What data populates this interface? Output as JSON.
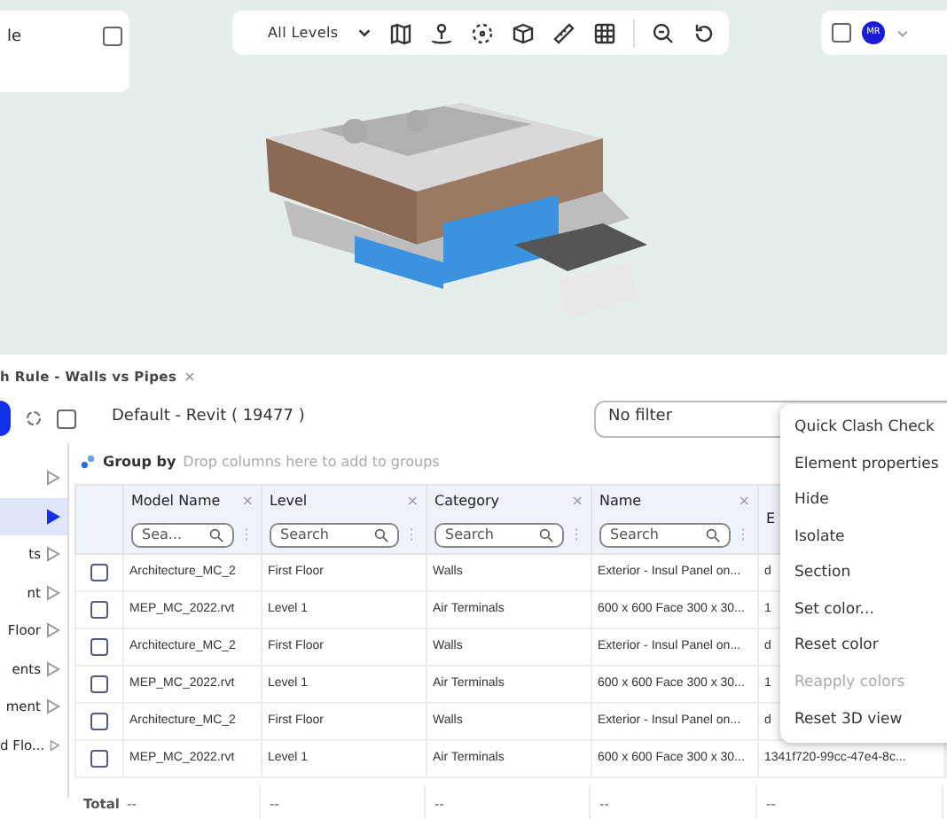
{
  "top_left_panel": {
    "title": "le"
  },
  "toolbar": {
    "level_select": "All Levels"
  },
  "user": {
    "initials": "MR"
  },
  "tab": {
    "title": "h Rule - Walls vs Pipes",
    "close": "×"
  },
  "view_title": "Default - Revit ( 19477 )",
  "filter": {
    "value": "No filter"
  },
  "group_by": {
    "label": "Group by",
    "placeholder": "Drop columns here to add to groups"
  },
  "sidebar": {
    "items": [
      {
        "selected": false
      },
      {
        "selected": true
      },
      {
        "label": "ts",
        "selected": false
      },
      {
        "label": "nt",
        "selected": false
      },
      {
        "label": "Floor",
        "selected": false
      },
      {
        "label": "ents",
        "selected": false
      },
      {
        "label": "ment",
        "selected": false
      },
      {
        "label": "d Flo...",
        "selected": false
      }
    ]
  },
  "table": {
    "columns": [
      {
        "title": "Model Name",
        "close": "×",
        "search": "Sea...",
        "menu": "⋮"
      },
      {
        "title": "Level",
        "close": "×",
        "search": "Search",
        "menu": "⋮"
      },
      {
        "title": "Category",
        "close": "×",
        "search": "Search",
        "menu": "⋮"
      },
      {
        "title": "Name",
        "close": "×",
        "search": "Search",
        "menu": "⋮"
      },
      {
        "title": "E"
      }
    ],
    "rows": [
      {
        "checked": false,
        "cells": [
          "Architecture_MC_2",
          "First Floor",
          "Walls",
          "Exterior - Insul Panel on...",
          "d"
        ]
      },
      {
        "checked": false,
        "cells": [
          "MEP_MC_2022.rvt",
          "Level 1",
          "Air Terminals",
          "600 x 600 Face 300 x 30...",
          "1"
        ]
      },
      {
        "checked": false,
        "cells": [
          "Architecture_MC_2",
          "First Floor",
          "Walls",
          "Exterior - Insul Panel on...",
          "d"
        ]
      },
      {
        "checked": false,
        "cells": [
          "MEP_MC_2022.rvt",
          "Level 1",
          "Air Terminals",
          "600 x 600 Face 300 x 30...",
          "1"
        ]
      },
      {
        "checked": false,
        "cells": [
          "Architecture_MC_2",
          "First Floor",
          "Walls",
          "Exterior - Insul Panel on...",
          "d"
        ]
      },
      {
        "checked": false,
        "cells": [
          "MEP_MC_2022.rvt",
          "Level 1",
          "Air Terminals",
          "600 x 600 Face 300 x 30...",
          "1341f720-99cc-47e4-8c..."
        ]
      }
    ],
    "total": {
      "label": "Total",
      "values": [
        "--",
        "--",
        "--",
        "--",
        "--"
      ]
    }
  },
  "context_menu": {
    "items": [
      {
        "label": "Quick Clash Check",
        "disabled": false
      },
      {
        "label": "Element properties",
        "disabled": false
      },
      {
        "label": "Hide",
        "disabled": false
      },
      {
        "label": "Isolate",
        "disabled": false
      },
      {
        "label": "Section",
        "disabled": false
      },
      {
        "label": "Set color...",
        "disabled": false
      },
      {
        "label": "Reset color",
        "disabled": false
      },
      {
        "label": "Reapply colors",
        "disabled": true
      },
      {
        "label": "Reset 3D view",
        "disabled": false
      }
    ]
  }
}
